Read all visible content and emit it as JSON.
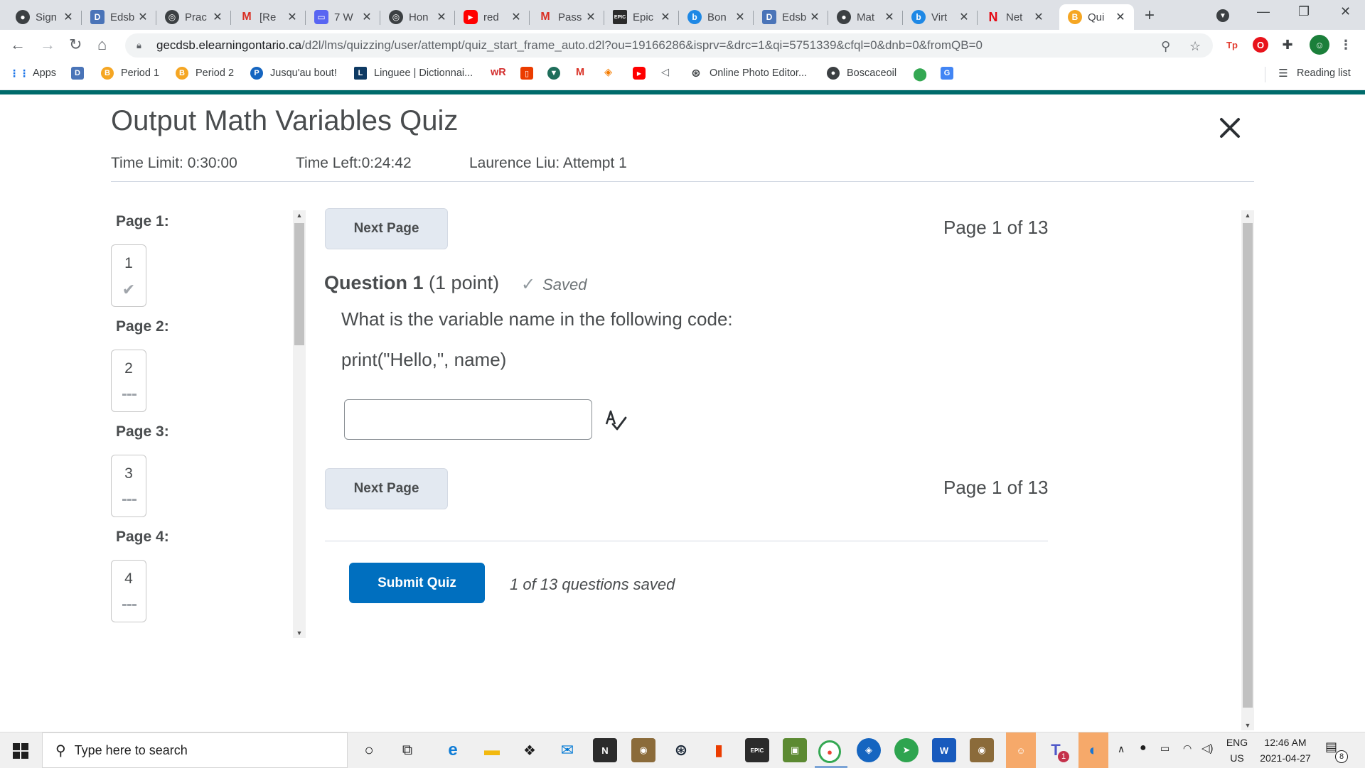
{
  "browser": {
    "tabs": [
      {
        "title": "Sign",
        "icon": "github-icon",
        "color": "#3c4043"
      },
      {
        "title": "Edsb",
        "icon": "d2l-icon",
        "color": "#4a74b8"
      },
      {
        "title": "Prac",
        "icon": "codehs-icon",
        "color": "#3c4043"
      },
      {
        "title": "[Re",
        "icon": "gmail-icon",
        "color": "#d93025"
      },
      {
        "title": "7 W",
        "icon": "discord-icon",
        "color": "#5865f2"
      },
      {
        "title": "Hon",
        "icon": "codehs-icon",
        "color": "#3c4043"
      },
      {
        "title": "red",
        "icon": "youtube-icon",
        "color": "#ff0000"
      },
      {
        "title": "Pass",
        "icon": "gmail-icon",
        "color": "#d93025"
      },
      {
        "title": "Epic",
        "icon": "epic-icon",
        "color": "#2b2b2b"
      },
      {
        "title": "Bon",
        "icon": "bing-icon",
        "color": "#1e88e5"
      },
      {
        "title": "Edsb",
        "icon": "d2l-icon",
        "color": "#4a74b8"
      },
      {
        "title": "Mat",
        "icon": "github-icon",
        "color": "#3c4043"
      },
      {
        "title": "Virt",
        "icon": "bing-icon",
        "color": "#1e88e5"
      },
      {
        "title": "Net",
        "icon": "netflix-icon",
        "color": "#e50914"
      },
      {
        "title": "Qui",
        "icon": "brightspace-icon",
        "color": "#f5a623",
        "active": true
      }
    ],
    "new_tab": "+",
    "url_host": "gecdsb.elearningontario.ca",
    "url_path": "/d2l/lms/quizzing/user/attempt/quiz_start_frame_auto.d2l?ou=19166286&isprv=&drc=1&qi=5751339&cfql=0&dnb=0&fromQB=0",
    "bookmarks": [
      {
        "label": "Apps",
        "icon": "apps-grid-icon"
      },
      {
        "label": "",
        "icon": "d2l-icon"
      },
      {
        "label": "Period 1",
        "icon": "brightspace-icon"
      },
      {
        "label": "Period 2",
        "icon": "brightspace-icon"
      },
      {
        "label": "Jusqu'au bout!",
        "icon": "p-icon"
      },
      {
        "label": "Linguee | Dictionnai...",
        "icon": "linguee-icon"
      },
      {
        "label": "Online Photo Editor...",
        "icon": "aperture-icon"
      },
      {
        "label": "Boscaceoil",
        "icon": "github-icon"
      }
    ],
    "reading_list": "Reading list"
  },
  "quiz": {
    "title": "Output Math Variables Quiz",
    "time_limit": "Time Limit: 0:30:00",
    "time_left": "Time Left:0:24:42",
    "attempt": "Laurence Liu: Attempt 1",
    "pages": [
      {
        "label": "Page 1:",
        "num": "1",
        "saved": true
      },
      {
        "label": "Page 2:",
        "num": "2",
        "saved": false
      },
      {
        "label": "Page 3:",
        "num": "3",
        "saved": false
      },
      {
        "label": "Page 4:",
        "num": "4",
        "saved": false
      }
    ],
    "next_page": "Next Page",
    "page_of": "Page 1 of 13",
    "question_label": "Question 1",
    "question_points": "(1 point)",
    "saved_label": "Saved",
    "question_text": "What is the variable name in the following code:",
    "question_code": "print(\"Hello,\", name)",
    "answer_value": "",
    "submit": "Submit Quiz",
    "saved_count": "1 of 13 questions saved"
  },
  "taskbar": {
    "search_placeholder": "Type here to search",
    "lang_top": "ENG",
    "lang_bottom": "US",
    "time": "12:46 AM",
    "date": "2021-04-27",
    "notif_count": "8",
    "teams_badge": "1"
  }
}
